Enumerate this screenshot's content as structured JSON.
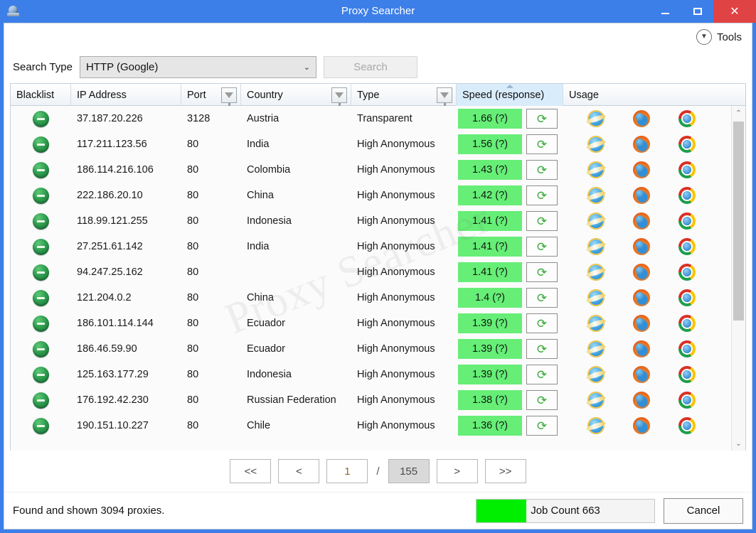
{
  "window": {
    "title": "Proxy Searcher",
    "app_icon": "globe-icon",
    "minimize_label": "Minimize",
    "maximize_label": "Maximize",
    "close_label": "✕",
    "frame_color": "#3d7fe8",
    "close_color": "#e04343"
  },
  "watermark": "Proxy Searcher",
  "toolbar": {
    "tools_label": "Tools",
    "tools_icon": "chevron-down-circle-icon"
  },
  "search": {
    "type_label": "Search Type",
    "type_value": "HTTP (Google)",
    "type_caret": "⌄",
    "search_button": "Search",
    "search_enabled": false
  },
  "grid": {
    "columns": [
      {
        "key": "blacklist",
        "label": "Blacklist",
        "filter": false,
        "sorted": false
      },
      {
        "key": "ip",
        "label": "IP Address",
        "filter": false,
        "sorted": false
      },
      {
        "key": "port",
        "label": "Port",
        "filter": true,
        "sorted": false
      },
      {
        "key": "country",
        "label": "Country",
        "filter": true,
        "sorted": false
      },
      {
        "key": "type",
        "label": "Type",
        "filter": true,
        "sorted": false
      },
      {
        "key": "speed",
        "label": "Speed (response)",
        "filter": false,
        "sorted": true
      },
      {
        "key": "usage",
        "label": "Usage",
        "filter": false,
        "sorted": false
      }
    ],
    "sort_direction": "ascending",
    "refresh_icon": "refresh-icon",
    "blacklist_icon": "green-minus-icon",
    "usage_icons": [
      "internet-explorer-icon",
      "firefox-icon",
      "chrome-icon"
    ],
    "speed_suffix": "(?)",
    "speed_chip_color": "#66ee77",
    "rows": [
      {
        "ip": "37.187.20.226",
        "port": "3128",
        "country": "Austria",
        "type": "Transparent",
        "speed": "1.66 (?)"
      },
      {
        "ip": "117.211.123.56",
        "port": "80",
        "country": "India",
        "type": "High Anonymous",
        "speed": "1.56 (?)"
      },
      {
        "ip": "186.114.216.106",
        "port": "80",
        "country": "Colombia",
        "type": "High Anonymous",
        "speed": "1.43 (?)"
      },
      {
        "ip": "222.186.20.10",
        "port": "80",
        "country": "China",
        "type": "High Anonymous",
        "speed": "1.42 (?)"
      },
      {
        "ip": "118.99.121.255",
        "port": "80",
        "country": "Indonesia",
        "type": "High Anonymous",
        "speed": "1.41 (?)"
      },
      {
        "ip": "27.251.61.142",
        "port": "80",
        "country": "India",
        "type": "High Anonymous",
        "speed": "1.41 (?)"
      },
      {
        "ip": "94.247.25.162",
        "port": "80",
        "country": "",
        "type": "High Anonymous",
        "speed": "1.41 (?)"
      },
      {
        "ip": "121.204.0.2",
        "port": "80",
        "country": "China",
        "type": "High Anonymous",
        "speed": "1.4 (?)"
      },
      {
        "ip": "186.101.114.144",
        "port": "80",
        "country": "Ecuador",
        "type": "High Anonymous",
        "speed": "1.39 (?)"
      },
      {
        "ip": "186.46.59.90",
        "port": "80",
        "country": "Ecuador",
        "type": "High Anonymous",
        "speed": "1.39 (?)"
      },
      {
        "ip": "125.163.177.29",
        "port": "80",
        "country": "Indonesia",
        "type": "High Anonymous",
        "speed": "1.39 (?)"
      },
      {
        "ip": "176.192.42.230",
        "port": "80",
        "country": "Russian Federation",
        "type": "High Anonymous",
        "speed": "1.38 (?)"
      },
      {
        "ip": "190.151.10.227",
        "port": "80",
        "country": "Chile",
        "type": "High Anonymous",
        "speed": "1.36 (?)"
      }
    ]
  },
  "scrollbar": {
    "up_arrow": "⌃",
    "down_arrow": "⌄",
    "thumb_position_percent": 0
  },
  "pager": {
    "first": "<<",
    "prev": "<",
    "current_page": "1",
    "separator": "/",
    "total_pages": "155",
    "next": ">",
    "last": ">>"
  },
  "status": {
    "text": "Found and shown 3094 proxies.",
    "job_label": "Job Count 663",
    "job_progress_percent": 28,
    "job_fill_color": "#00ef00",
    "cancel_label": "Cancel"
  }
}
